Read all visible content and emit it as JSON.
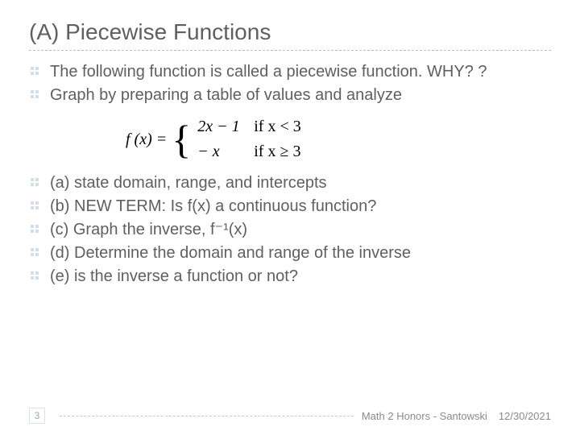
{
  "title": "(A) Piecewise Functions",
  "bullets_top": [
    "The following function is called a piecewise function. WHY? ?",
    "Graph by preparing a table of values and analyze"
  ],
  "equation": {
    "lhs": "f (x) =",
    "cases": [
      {
        "expr": "2x − 1",
        "cond": "if  x < 3"
      },
      {
        "expr": "− x",
        "cond": "if  x ≥ 3"
      }
    ]
  },
  "bullets_bottom": [
    "(a) state domain, range, and intercepts",
    "(b) NEW TERM: Is f(x) a continuous function?",
    "(c) Graph the inverse, f⁻¹(x)",
    "(d) Determine the domain and  range of the inverse",
    "(e) is the inverse a function or not?"
  ],
  "footer": {
    "page": "3",
    "course": "Math 2 Honors - Santowski",
    "date": "12/30/2021"
  }
}
